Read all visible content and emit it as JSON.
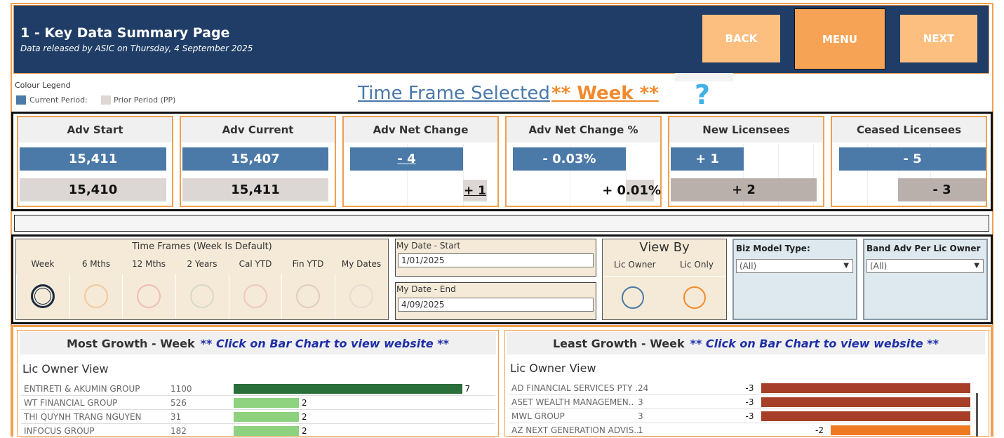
{
  "header": {
    "title": "1 - Key Data Summary Page",
    "subtitle": "Data released by ASIC on Thursday, 4 September 2025",
    "back_label": "BACK",
    "menu_label": "MENU",
    "next_label": "NEXT"
  },
  "legend": {
    "title": "Colour Legend",
    "current_label": "Current Period:",
    "prior_label": "Prior Period (PP)",
    "current_color": "#4b79a8",
    "prior_color": "#dcd6d4"
  },
  "time_frame": {
    "label": "Time Frame Selected",
    "value": "** Week **",
    "help": "?"
  },
  "kpis": [
    {
      "title": "Adv Start",
      "current": "15,411",
      "prior": "15,410"
    },
    {
      "title": "Adv Current",
      "current": "15,407",
      "prior": "15,411"
    },
    {
      "title": "Adv Net Change",
      "current": "- 4",
      "prior": "+ 1"
    },
    {
      "title": "Adv Net Change %",
      "current": "- 0.03%",
      "prior": "+ 0.01%"
    },
    {
      "title": "New Licensees",
      "current": "+ 1",
      "prior": "+ 2"
    },
    {
      "title": "Ceased Licensees",
      "current": "- 5",
      "prior": "- 3"
    }
  ],
  "filters": {
    "time_frames_title": "Time Frames (Week Is Default)",
    "options": [
      "Week",
      "6 Mths",
      "12 Mths",
      "2 Years",
      "Cal YTD",
      "Fin YTD",
      "My Dates"
    ],
    "selected": "Week",
    "date_start_label": "My Date - Start",
    "date_start_value": "1/01/2025",
    "date_end_label": "My Date - End",
    "date_end_value": "4/09/2025",
    "view_by_title": "View By",
    "view_by_options": [
      "Lic Owner",
      "Lic Only"
    ],
    "biz_model_label": "Biz Model Type:",
    "biz_model_value": "(All)",
    "band_label": "Band Adv Per Lic Owner",
    "band_value": "(All)"
  },
  "most_growth": {
    "title": "Most Growth - Week",
    "hint": "** Click on Bar Chart to view website **",
    "subtitle": "Lic Owner View",
    "rows": [
      {
        "name": "ENTIRETI & AKUMIN GROUP",
        "advisers": "1100",
        "change": 7
      },
      {
        "name": "WT FINANCIAL GROUP",
        "advisers": "526",
        "change": 2
      },
      {
        "name": "THI QUYNH TRANG  NGUYEN",
        "advisers": "31",
        "change": 2
      },
      {
        "name": "INFOCUS GROUP",
        "advisers": "182",
        "change": 2
      }
    ]
  },
  "least_growth": {
    "title": "Least Growth - Week",
    "hint": "** Click on Bar Chart to view website **",
    "subtitle": "Lic Owner View",
    "rows": [
      {
        "name": "AD FINANCIAL SERVICES PTY ..",
        "advisers": "24",
        "change": -3
      },
      {
        "name": "ASET WEALTH MANAGEMEN..",
        "advisers": "3",
        "change": -3
      },
      {
        "name": "MWL GROUP",
        "advisers": "3",
        "change": -3
      },
      {
        "name": "AZ NEXT GENERATION ADVIS..",
        "advisers": "1",
        "change": -2
      }
    ]
  }
}
